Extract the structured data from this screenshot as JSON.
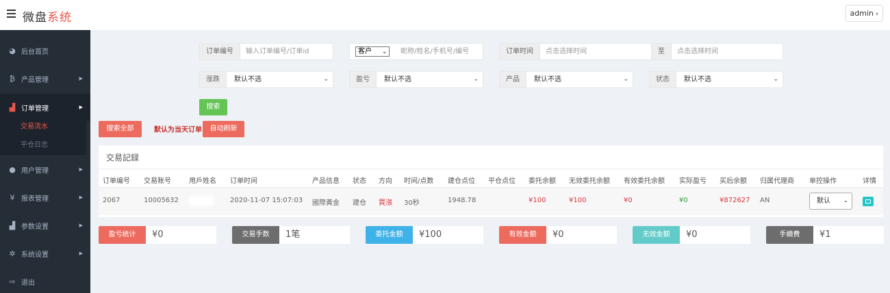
{
  "header": {
    "logo_main": "微盘",
    "logo_accent": "系统",
    "admin_label": "admin",
    "admin_caret": "▾"
  },
  "sidebar": {
    "items": [
      {
        "label": "后台首页",
        "icon": "dashboard-icon",
        "glyph": "◕"
      },
      {
        "label": "产品管理",
        "icon": "bitcoin-icon",
        "glyph": "₿"
      },
      {
        "label": "订单管理",
        "icon": "copy-icon",
        "glyph": "▟"
      },
      {
        "label": "用户管理",
        "icon": "user-icon",
        "glyph": "●"
      },
      {
        "label": "报表管理",
        "icon": "yen-icon",
        "glyph": "¥"
      },
      {
        "label": "参数设置",
        "icon": "copy-icon",
        "glyph": "▟"
      },
      {
        "label": "系统设置",
        "icon": "gears-icon",
        "glyph": "✲"
      },
      {
        "label": "退出",
        "icon": "signout-icon",
        "glyph": "⇨"
      }
    ],
    "subitems": [
      {
        "label": "交易流水"
      },
      {
        "label": "平仓日志"
      }
    ],
    "arrow": "▶"
  },
  "filters": {
    "order_no": {
      "label": "订单编号",
      "placeholder": "输入订单编号/订单id"
    },
    "customer": {
      "select_value": "客户",
      "placeholder": "昵称/姓名/手机号/编号"
    },
    "order_time": {
      "label": "订单时间",
      "placeholder": "点击选择时间",
      "to_label": "至",
      "to_placeholder": "点击选择时间"
    },
    "rise_fall": {
      "label": "涨跌",
      "value": "默认不选"
    },
    "profit": {
      "label": "盈亏",
      "value": "默认不选"
    },
    "product": {
      "label": "产品",
      "value": "默认不选"
    },
    "status": {
      "label": "状态",
      "value": "默认不选"
    },
    "chevron": "⌄"
  },
  "buttons": {
    "search": "搜索",
    "search_all": "搜索全部",
    "default_today": "默认为当天订单",
    "auto_refresh": "自动刷新"
  },
  "table": {
    "title": "交易記録",
    "headers": [
      "订单编号",
      "交易账号",
      "用戶姓名",
      "订单时间",
      "产品信息",
      "状态",
      "方向",
      "时间/点数",
      "建仓点位",
      "平仓点位",
      "委托余额",
      "无效委托余额",
      "有效委托余额",
      "实际盈亏",
      "买后余额",
      "归属代理商",
      "单控操作",
      "详情"
    ],
    "rows": [
      {
        "order_no": "2067",
        "account": "10005632",
        "time": "2020-11-07 15:07:03",
        "product": "國際黃金",
        "status": "建仓",
        "direction": "買漲",
        "duration": "30秒",
        "open_price": "1948.78",
        "close_price": "",
        "entrust": "¥100",
        "invalid": "¥100",
        "valid": "¥0",
        "pnl": "¥0",
        "balance": "¥872627",
        "agent": "AN",
        "control": "默认"
      }
    ]
  },
  "stats": [
    {
      "label": "盈亏统计",
      "value": "¥0",
      "color": "#ec6b5e"
    },
    {
      "label": "交易手数",
      "value": "1笔",
      "color": "#6d6d6d"
    },
    {
      "label": "委托金额",
      "value": "¥100",
      "color": "#3fb2ea"
    },
    {
      "label": "有效金额",
      "value": "¥0",
      "color": "#ec6b5e"
    },
    {
      "label": "无效金额",
      "value": "¥0",
      "color": "#62cbc9"
    },
    {
      "label": "手續費",
      "value": "¥1",
      "color": "#6d6d6d"
    }
  ]
}
